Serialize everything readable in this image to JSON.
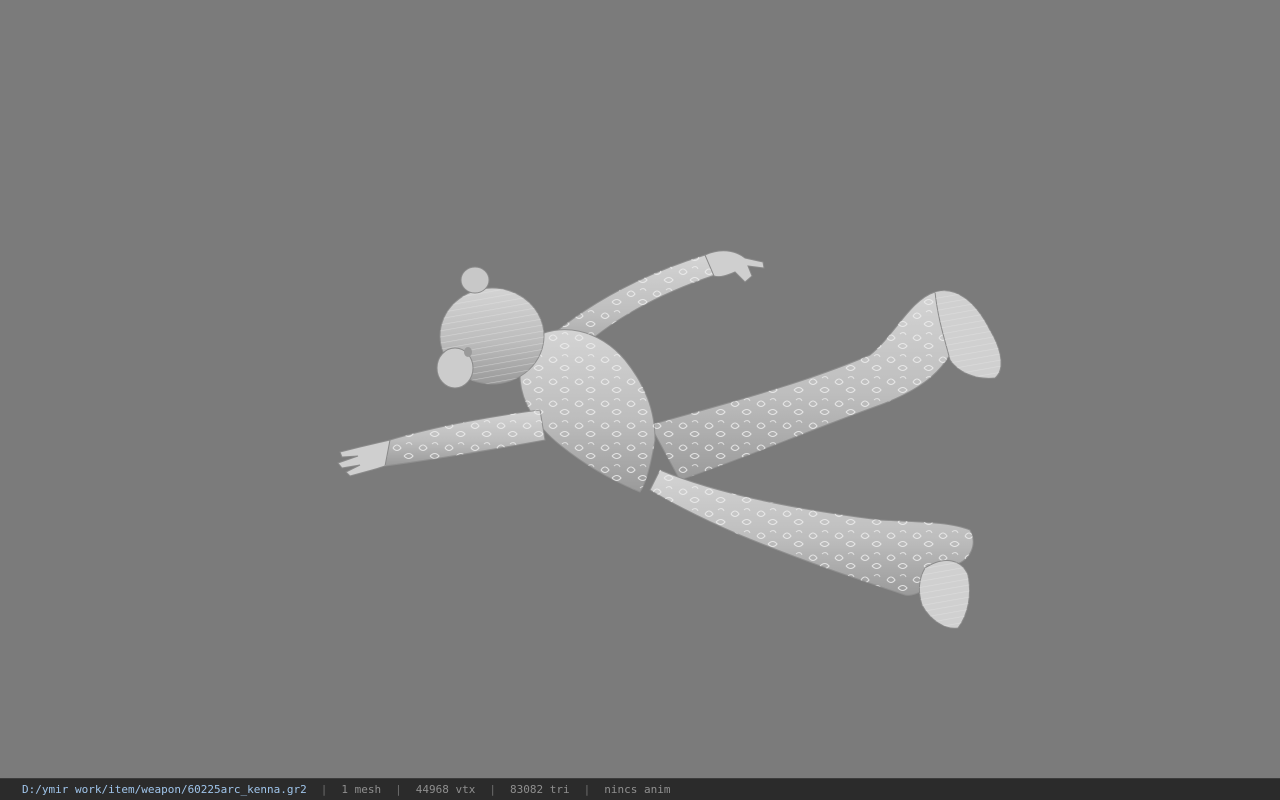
{
  "viewport": {
    "background_color": "#7b7b7b",
    "model": {
      "icon": "figure-model",
      "surface_color": "#c4c4c4",
      "pattern_color": "#eeeeee",
      "shadow_color": "#969696"
    }
  },
  "statusbar": {
    "path": "D:/ymir work/item/weapon/60225arc_kenna.gr2",
    "mesh": "1 mesh",
    "vertices": "44968 vtx",
    "triangles": "83082 tri",
    "animation": "nincs anim",
    "separator": "|",
    "path_color": "#9fc4ea",
    "text_color": "#8f8f8f"
  }
}
